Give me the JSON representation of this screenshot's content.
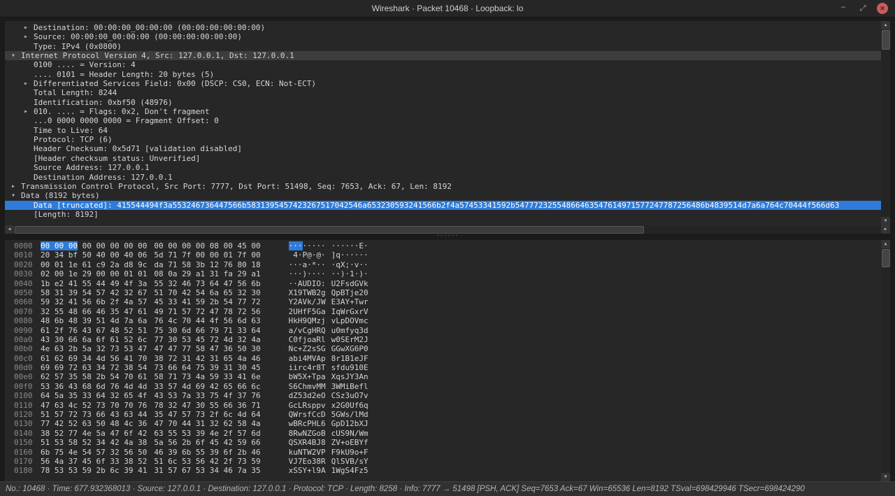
{
  "window": {
    "title": "Wireshark · Packet 10468 · Loopback: lo",
    "controls": {
      "minimize": "–",
      "maximize": "⤢",
      "close": "✕"
    }
  },
  "colors": {
    "selection": "#2f7bd9",
    "close_button": "#cc5b5b"
  },
  "tree": {
    "rows": [
      {
        "indent": 1,
        "arrow": "right",
        "text": "Destination: 00:00:00_00:00:00 (00:00:00:00:00:00)"
      },
      {
        "indent": 1,
        "arrow": "right",
        "text": "Source: 00:00:00_00:00:00 (00:00:00:00:00:00)"
      },
      {
        "indent": 1,
        "arrow": "none",
        "text": "Type: IPv4 (0x0800)"
      },
      {
        "indent": 0,
        "arrow": "down",
        "text": "Internet Protocol Version 4, Src: 127.0.0.1, Dst: 127.0.0.1",
        "emph": true
      },
      {
        "indent": 1,
        "arrow": "none",
        "text": "0100 .... = Version: 4"
      },
      {
        "indent": 1,
        "arrow": "none",
        "text": ".... 0101 = Header Length: 20 bytes (5)"
      },
      {
        "indent": 1,
        "arrow": "right",
        "text": "Differentiated Services Field: 0x00 (DSCP: CS0, ECN: Not-ECT)"
      },
      {
        "indent": 1,
        "arrow": "none",
        "text": "Total Length: 8244"
      },
      {
        "indent": 1,
        "arrow": "none",
        "text": "Identification: 0xbf50 (48976)"
      },
      {
        "indent": 1,
        "arrow": "right",
        "text": "010. .... = Flags: 0x2, Don't fragment"
      },
      {
        "indent": 1,
        "arrow": "none",
        "text": "...0 0000 0000 0000 = Fragment Offset: 0"
      },
      {
        "indent": 1,
        "arrow": "none",
        "text": "Time to Live: 64"
      },
      {
        "indent": 1,
        "arrow": "none",
        "text": "Protocol: TCP (6)"
      },
      {
        "indent": 1,
        "arrow": "none",
        "text": "Header Checksum: 0x5d71 [validation disabled]"
      },
      {
        "indent": 1,
        "arrow": "none",
        "text": "[Header checksum status: Unverified]"
      },
      {
        "indent": 1,
        "arrow": "none",
        "text": "Source Address: 127.0.0.1"
      },
      {
        "indent": 1,
        "arrow": "none",
        "text": "Destination Address: 127.0.0.1"
      },
      {
        "indent": 0,
        "arrow": "right",
        "text": "Transmission Control Protocol, Src Port: 7777, Dst Port: 51498, Seq: 7653, Ack: 67, Len: 8192"
      },
      {
        "indent": 0,
        "arrow": "down",
        "text": "Data (8192 bytes)"
      },
      {
        "indent": 1,
        "arrow": "none",
        "text": "Data [truncated]: 415544494f3a553246736447566b5831395457423267517042546a653230593241566b2f4a57453341592b54777232554866463547614971577247787256486b4839514d7a6a764c70444f566d63",
        "selected": true
      },
      {
        "indent": 1,
        "arrow": "none",
        "text": "[Length: 8192]"
      }
    ]
  },
  "hex": {
    "highlight": {
      "row": 0,
      "hex_chars": 8,
      "ascii_chars": 3
    },
    "rows": [
      {
        "offset": "0000",
        "hex1": "00 00 00 00 00 00 00 00",
        "hex2": "00 00 00 00 08 00 45 00",
        "ascii1": "········",
        "ascii2": "······E·"
      },
      {
        "offset": "0010",
        "hex1": "20 34 bf 50 40 00 40 06",
        "hex2": "5d 71 7f 00 00 01 7f 00",
        "ascii1": " 4·P@·@·",
        "ascii2": "]q······"
      },
      {
        "offset": "0020",
        "hex1": "00 01 1e 61 c9 2a d8 9c",
        "hex2": "da 71 58 3b 12 76 80 18",
        "ascii1": "···a·*··",
        "ascii2": "·qX;·v··"
      },
      {
        "offset": "0030",
        "hex1": "02 00 1e 29 00 00 01 01",
        "hex2": "08 0a 29 a1 31 fa 29 a1",
        "ascii1": "···)····",
        "ascii2": "··)·1·)·"
      },
      {
        "offset": "0040",
        "hex1": "1b e2 41 55 44 49 4f 3a",
        "hex2": "55 32 46 73 64 47 56 6b",
        "ascii1": "··AUDIO:",
        "ascii2": "U2FsdGVk"
      },
      {
        "offset": "0050",
        "hex1": "58 31 39 54 57 42 32 67",
        "hex2": "51 70 42 54 6a 65 32 30",
        "ascii1": "X19TWB2g",
        "ascii2": "QpBTje20"
      },
      {
        "offset": "0060",
        "hex1": "59 32 41 56 6b 2f 4a 57",
        "hex2": "45 33 41 59 2b 54 77 72",
        "ascii1": "Y2AVk/JW",
        "ascii2": "E3AY+Twr"
      },
      {
        "offset": "0070",
        "hex1": "32 55 48 66 46 35 47 61",
        "hex2": "49 71 57 72 47 78 72 56",
        "ascii1": "2UHfF5Ga",
        "ascii2": "IqWrGxrV"
      },
      {
        "offset": "0080",
        "hex1": "48 6b 48 39 51 4d 7a 6a",
        "hex2": "76 4c 70 44 4f 56 6d 63",
        "ascii1": "HkH9QMzj",
        "ascii2": "vLpDOVmc"
      },
      {
        "offset": "0090",
        "hex1": "61 2f 76 43 67 48 52 51",
        "hex2": "75 30 6d 66 79 71 33 64",
        "ascii1": "a/vCgHRQ",
        "ascii2": "u0mfyq3d"
      },
      {
        "offset": "00a0",
        "hex1": "43 30 66 6a 6f 61 52 6c",
        "hex2": "77 30 53 45 72 4d 32 4a",
        "ascii1": "C0fjoaRl",
        "ascii2": "w0SErM2J"
      },
      {
        "offset": "00b0",
        "hex1": "4e 63 2b 5a 32 73 53 47",
        "hex2": "47 47 77 58 47 36 50 30",
        "ascii1": "Nc+Z2sSG",
        "ascii2": "GGwXG6P0"
      },
      {
        "offset": "00c0",
        "hex1": "61 62 69 34 4d 56 41 70",
        "hex2": "38 72 31 42 31 65 4a 46",
        "ascii1": "abi4MVAp",
        "ascii2": "8r1B1eJF"
      },
      {
        "offset": "00d0",
        "hex1": "69 69 72 63 34 72 38 54",
        "hex2": "73 66 64 75 39 31 30 45",
        "ascii1": "iirc4r8T",
        "ascii2": "sfdu910E"
      },
      {
        "offset": "00e0",
        "hex1": "62 57 35 58 2b 54 70 61",
        "hex2": "58 71 73 4a 59 33 41 6e",
        "ascii1": "bW5X+Tpa",
        "ascii2": "XqsJY3An"
      },
      {
        "offset": "00f0",
        "hex1": "53 36 43 68 6d 76 4d 4d",
        "hex2": "33 57 4d 69 42 65 66 6c",
        "ascii1": "S6ChmvMM",
        "ascii2": "3WMiBefl"
      },
      {
        "offset": "0100",
        "hex1": "64 5a 35 33 64 32 65 4f",
        "hex2": "43 53 7a 33 75 4f 37 76",
        "ascii1": "dZ53d2eO",
        "ascii2": "CSz3uO7v"
      },
      {
        "offset": "0110",
        "hex1": "47 63 4c 52 73 70 70 76",
        "hex2": "78 32 47 30 55 66 36 71",
        "ascii1": "GcLRsppv",
        "ascii2": "x2G0Uf6q"
      },
      {
        "offset": "0120",
        "hex1": "51 57 72 73 66 43 63 44",
        "hex2": "35 47 57 73 2f 6c 4d 64",
        "ascii1": "QWrsfCcD",
        "ascii2": "5GWs/lMd"
      },
      {
        "offset": "0130",
        "hex1": "77 42 52 63 50 48 4c 36",
        "hex2": "47 70 44 31 32 62 58 4a",
        "ascii1": "wBRcPHL6",
        "ascii2": "GpD12bXJ"
      },
      {
        "offset": "0140",
        "hex1": "38 52 77 4e 5a 47 6f 42",
        "hex2": "63 55 53 39 4e 2f 57 6d",
        "ascii1": "8RwNZGoB",
        "ascii2": "cUS9N/Wm"
      },
      {
        "offset": "0150",
        "hex1": "51 53 58 52 34 42 4a 38",
        "hex2": "5a 56 2b 6f 45 42 59 66",
        "ascii1": "QSXR4BJ8",
        "ascii2": "ZV+oEBYf"
      },
      {
        "offset": "0160",
        "hex1": "6b 75 4e 54 57 32 56 50",
        "hex2": "46 39 6b 55 39 6f 2b 46",
        "ascii1": "kuNTW2VP",
        "ascii2": "F9kU9o+F"
      },
      {
        "offset": "0170",
        "hex1": "56 4a 37 45 6f 33 38 52",
        "hex2": "51 6c 53 56 42 2f 73 59",
        "ascii1": "VJ7Eo38R",
        "ascii2": "QlSVB/sY"
      },
      {
        "offset": "0180",
        "hex1": "78 53 53 59 2b 6c 39 41",
        "hex2": "31 57 67 53 34 46 7a 35",
        "ascii1": "xSSY+l9A",
        "ascii2": "1WgS4Fz5"
      }
    ]
  },
  "scrollbar": {
    "splitter_dots": "······"
  },
  "status": {
    "text": "No.: 10468 · Time: 677.932368013 · Source: 127.0.0.1 · Destination: 127.0.0.1 · Protocol: TCP · Length: 8258 · Info: 7777 → 51498 [PSH, ACK] Seq=7653 Ack=67 Win=65536 Len=8192 TSval=698429946 TSecr=698424290"
  }
}
